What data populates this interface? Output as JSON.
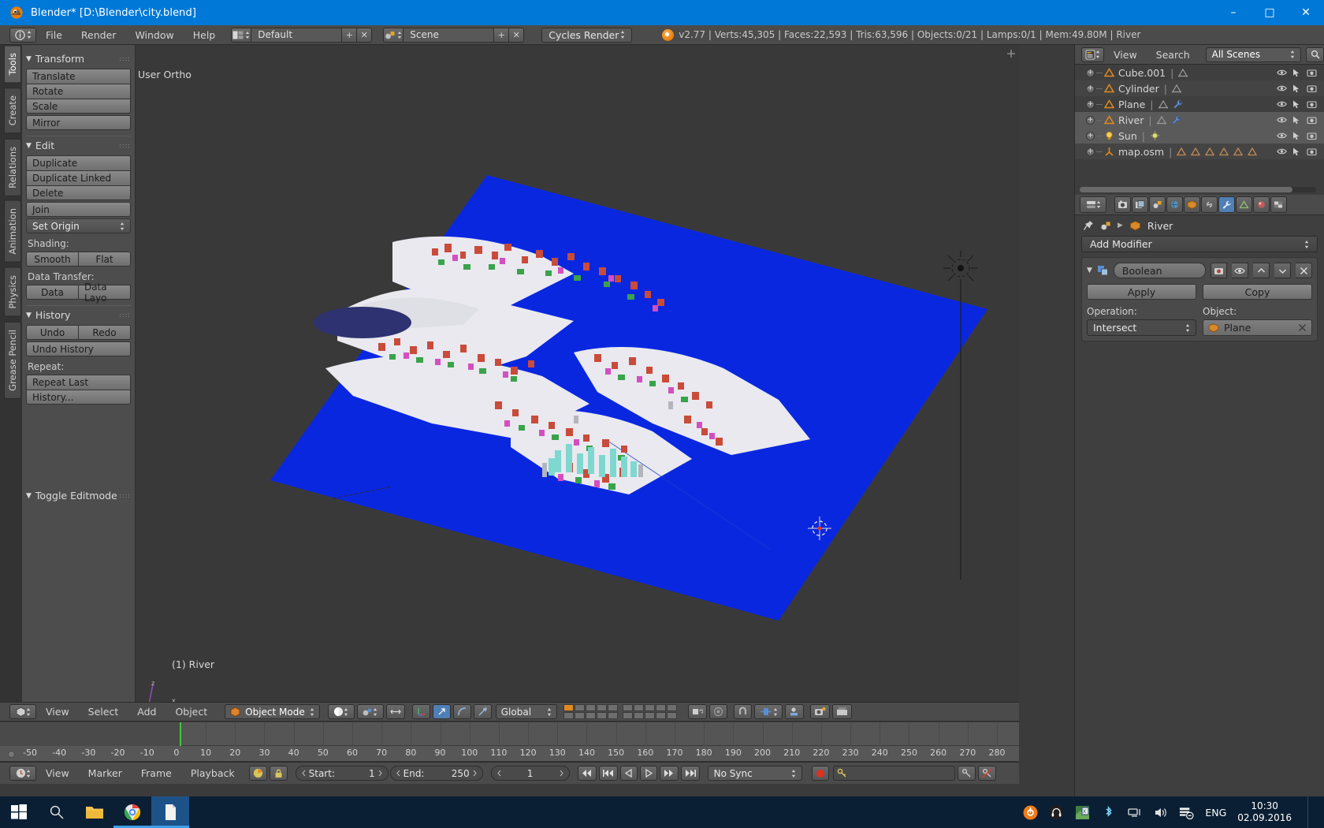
{
  "window": {
    "title": "Blender* [D:\\Blender\\city.blend]",
    "minimize": "–",
    "maximize": "□",
    "close": "✕"
  },
  "info_header": {
    "menus": [
      "File",
      "Render",
      "Window",
      "Help"
    ],
    "screen_layout": "Default",
    "scene_name": "Scene",
    "render_engine": "Cycles Render",
    "add_label": "+",
    "delete_label": "✕",
    "stats": "v2.77 | Verts:45,305 | Faces:22,593 | Tris:63,596 | Objects:0/21 | Lamps:0/1 | Mem:49.80M | River"
  },
  "tool_tabs": [
    {
      "label": "Tools",
      "active": true
    },
    {
      "label": "Create",
      "active": false
    },
    {
      "label": "Relations",
      "active": false
    },
    {
      "label": "Animation",
      "active": false
    },
    {
      "label": "Physics",
      "active": false
    },
    {
      "label": "Grease Pencil",
      "active": false
    }
  ],
  "tool_panel": {
    "transform": {
      "title": "Transform",
      "buttons": [
        "Translate",
        "Rotate",
        "Scale"
      ],
      "mirror": "Mirror"
    },
    "edit": {
      "title": "Edit",
      "buttons": [
        "Duplicate",
        "Duplicate Linked",
        "Delete"
      ],
      "join": "Join",
      "set_origin": "Set Origin",
      "shading_label": "Shading:",
      "shading": [
        "Smooth",
        "Flat"
      ],
      "data_transfer_label": "Data Transfer:",
      "data_transfer": [
        "Data",
        "Data Layo"
      ]
    },
    "history": {
      "title": "History",
      "undo": "Undo",
      "redo": "Redo",
      "undo_history": "Undo History",
      "repeat_label": "Repeat:",
      "repeat_last": "Repeat Last",
      "history": "History..."
    },
    "toggle_editmode": "Toggle Editmode"
  },
  "viewport": {
    "view_label": "User Ortho",
    "active_object_label": "(1) River"
  },
  "viewport_header": {
    "menus": [
      "View",
      "Select",
      "Add",
      "Object"
    ],
    "mode": "Object Mode",
    "transform_orientation": "Global"
  },
  "timeline_ruler": {
    "ticks": [
      "-50",
      "-40",
      "-30",
      "-20",
      "-10",
      "0",
      "10",
      "20",
      "30",
      "40",
      "50",
      "60",
      "70",
      "80",
      "90",
      "100",
      "110",
      "120",
      "130",
      "140",
      "150",
      "160",
      "170",
      "180",
      "190",
      "200",
      "210",
      "220",
      "230",
      "240",
      "250",
      "260",
      "270",
      "280"
    ],
    "current_frame_marker": 1
  },
  "timeline_header": {
    "menus": [
      "View",
      "Marker",
      "Frame",
      "Playback"
    ],
    "start_label": "Start:",
    "start_value": "1",
    "end_label": "End:",
    "end_value": "250",
    "current_frame": "1",
    "sync_mode": "No Sync"
  },
  "outliner": {
    "menus": [
      "View",
      "Search"
    ],
    "scene_filter": "All Scenes",
    "rows": [
      {
        "name": "Cube.001",
        "type": "mesh",
        "selected": false,
        "has_modifier": false,
        "extra_meshes": 0
      },
      {
        "name": "Cylinder",
        "type": "mesh",
        "selected": false,
        "has_modifier": false,
        "extra_meshes": 0
      },
      {
        "name": "Plane",
        "type": "mesh",
        "selected": false,
        "has_modifier": true,
        "extra_meshes": 0
      },
      {
        "name": "River",
        "type": "mesh",
        "selected": true,
        "has_modifier": true,
        "extra_meshes": 0
      },
      {
        "name": "Sun",
        "type": "lamp",
        "selected": true,
        "has_modifier": false,
        "extra_meshes": 0
      },
      {
        "name": "map.osm",
        "type": "empty",
        "selected": false,
        "has_modifier": false,
        "extra_meshes": 6
      }
    ]
  },
  "properties": {
    "breadcrumb_object": "River",
    "add_modifier": "Add Modifier",
    "modifier": {
      "type": "Boolean",
      "apply": "Apply",
      "copy": "Copy",
      "operation_label": "Operation:",
      "operation_value": "Intersect",
      "object_label": "Object:",
      "object_value": "Plane"
    }
  },
  "taskbar": {
    "items": [
      "start-icon",
      "search-icon",
      "file-explorer-icon",
      "chrome-icon",
      "blender-icon"
    ],
    "tray": [
      "cloud-icon",
      "headphones-icon",
      "maps-icon",
      "bluetooth-icon",
      "network-icon",
      "volume-icon",
      "action-center-icon"
    ],
    "language": "ENG",
    "time": "10:30",
    "date": "02.09.2016"
  },
  "colors": {
    "accent_blue": "#0078d7",
    "river_blue": "#0a27e0",
    "header_gray": "#4b4b4b",
    "viewport_gray": "#393939",
    "active_tab_blue": "#4f7fb5"
  }
}
